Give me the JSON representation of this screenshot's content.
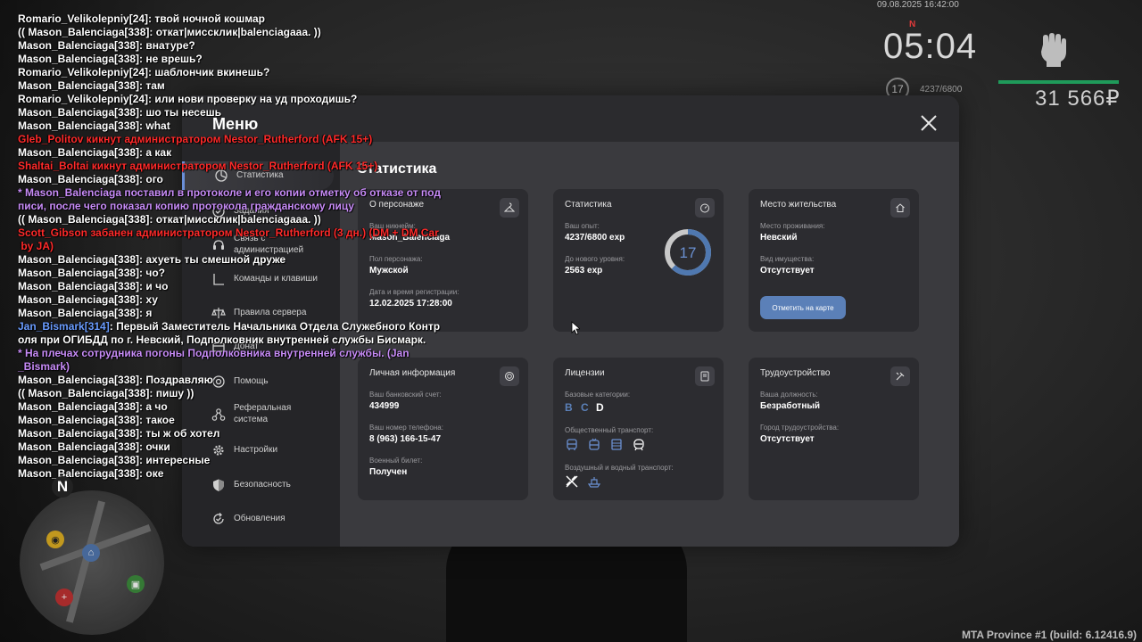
{
  "hud": {
    "datetime": "09.08.2025 16:42:00",
    "north_marker": "N",
    "time": "05:04",
    "level": "17",
    "exp": "4237/6800",
    "money": "31 566₽",
    "build": "MTA Province #1 (build: 6.12416.9)"
  },
  "chat": [
    {
      "type": "white",
      "text": "Romario_Velikolepniy[24]: твой ночной кошмар"
    },
    {
      "type": "white",
      "text": "(( Mason_Balenciaga[338]: откат|миссклик|balenciagaaa. ))"
    },
    {
      "type": "white",
      "text": "Mason_Balenciaga[338]: внатуре?"
    },
    {
      "type": "white",
      "text": "Mason_Balenciaga[338]: не врешь?"
    },
    {
      "type": "white",
      "text": "Romario_Velikolepniy[24]: шаблончик вкинешь?"
    },
    {
      "type": "white",
      "text": "Mason_Balenciaga[338]: там"
    },
    {
      "type": "white",
      "text": "Romario_Velikolepniy[24]: или нови проверку на уд проходишь?"
    },
    {
      "type": "white",
      "text": "Mason_Balenciaga[338]: шо ты несешь"
    },
    {
      "type": "white",
      "text": "Mason_Balenciaga[338]: what"
    },
    {
      "type": "red",
      "text": "Gleb_Politov кикнут администратором Nestor_Rutherford (AFK 15+)"
    },
    {
      "type": "white",
      "text": "Mason_Balenciaga[338]: а как"
    },
    {
      "type": "red",
      "text": "Shaltai_Boltai кикнут администратором Nestor_Rutherford (AFK 15+)"
    },
    {
      "type": "white",
      "text": "Mason_Balenciaga[338]: ого"
    },
    {
      "type": "purple",
      "text": "* Mason_Balenciaga поставил в протоколе и его копии отметку об отказе от под\nписи, после чего показал копию протокола гражданскому лицу"
    },
    {
      "type": "white",
      "text": "(( Mason_Balenciaga[338]: откат|миссклик|balenciagaaa. ))"
    },
    {
      "type": "red",
      "text": "Scott_Gibson забанен администратором Nestor_Rutherford (3 дн.) (DM + DM Car\n by JA)"
    },
    {
      "type": "white",
      "text": "Mason_Balenciaga[338]: ахуеть ты смешной друже"
    },
    {
      "type": "white",
      "text": "Mason_Balenciaga[338]: чо?"
    },
    {
      "type": "white",
      "text": "Mason_Balenciaga[338]: и чо"
    },
    {
      "type": "white",
      "text": "Mason_Balenciaga[338]: ху"
    },
    {
      "type": "white",
      "text": "Mason_Balenciaga[338]: я"
    },
    {
      "type": "blue",
      "nick": "Jan_Bismark[314]",
      "text": ": Первый Заместитель Начальника Отдела Служебного Контр\nоля при ОГИБДД по г. Невский, Подполковник внутренней службы Бисмарк."
    },
    {
      "type": "purple",
      "text": "* На плечах сотрудника погоны Подполковника внутренней службы. (Jan\n_Bismark)"
    },
    {
      "type": "white",
      "text": "Mason_Balenciaga[338]: Поздравляю"
    },
    {
      "type": "white",
      "text": "(( Mason_Balenciaga[338]: пишу ))"
    },
    {
      "type": "white",
      "text": "Mason_Balenciaga[338]: а чо"
    },
    {
      "type": "white",
      "text": "Mason_Balenciaga[338]: такое"
    },
    {
      "type": "white",
      "text": "Mason_Balenciaga[338]: ты ж об хотел"
    },
    {
      "type": "white",
      "text": "Mason_Balenciaga[338]: очки"
    },
    {
      "type": "white",
      "text": "Mason_Balenciaga[338]: интересные"
    },
    {
      "type": "white",
      "text": "Mason_Balenciaga[338]: оке"
    }
  ],
  "minimap": {
    "north": "N"
  },
  "menu": {
    "title": "Меню",
    "sidebar": [
      {
        "label": "Статистика",
        "icon": "stats-icon",
        "active": true
      },
      {
        "label": "Задания",
        "icon": "tasks-icon"
      },
      {
        "label": "Связь с администрацией",
        "icon": "support-icon"
      },
      {
        "label": "Команды и клавиши",
        "icon": "keys-icon"
      },
      {
        "label": "Правила сервера",
        "icon": "rules-icon"
      },
      {
        "label": "Донат",
        "icon": "donate-icon"
      },
      {
        "label": "Помощь",
        "icon": "help-icon"
      },
      {
        "label": "Реферальная система",
        "icon": "referral-icon"
      },
      {
        "label": "Настройки",
        "icon": "gear-icon"
      },
      {
        "label": "Безопасность",
        "icon": "shield-icon"
      },
      {
        "label": "Обновления",
        "icon": "update-icon"
      }
    ],
    "content_title": "Статистика",
    "cards": {
      "about": {
        "title": "О персонаже",
        "nick_label": "Ваш никнейм:",
        "nick": "Mason_Balenciaga",
        "gender_label": "Пол персонажа:",
        "gender": "Мужской",
        "reg_label": "Дата и время регистрации:",
        "reg": "12.02.2025 17:28:00"
      },
      "stats": {
        "title": "Статистика",
        "exp_label": "Ваш опыт:",
        "exp": "4237/6800 exp",
        "next_label": "До нового уровня:",
        "next": "2563 exp",
        "level": "17",
        "progress": 0.623
      },
      "residence": {
        "title": "Место жительства",
        "place_label": "Место проживания:",
        "place": "Невский",
        "property_label": "Вид имущества:",
        "property": "Отсутствует",
        "map_button": "Отметить на карте"
      },
      "personal": {
        "title": "Личная информация",
        "bank_label": "Ваш банковский счет:",
        "bank": "434999",
        "phone_label": "Ваш номер телефона:",
        "phone": "8 (963) 166-15-47",
        "military_label": "Военный билет:",
        "military": "Получен"
      },
      "licenses": {
        "title": "Лицензии",
        "basic_label": "Базовые категории:",
        "categories": [
          {
            "letter": "B",
            "owned": true
          },
          {
            "letter": "C",
            "owned": true
          },
          {
            "letter": "D",
            "owned": false
          }
        ],
        "public_label": "Общественный транспорт:",
        "air_label": "Воздушный и водный транспорт:"
      },
      "job": {
        "title": "Трудоустройство",
        "position_label": "Ваша должность:",
        "position": "Безработный",
        "city_label": "Город трудоустройства:",
        "city": "Отсутствует"
      }
    }
  },
  "colors": {
    "accent": "#5b80b8",
    "owned_category": "#5b80b8",
    "ring_bg": "#c8c8c8",
    "ring_fg": "#4f78b0"
  }
}
